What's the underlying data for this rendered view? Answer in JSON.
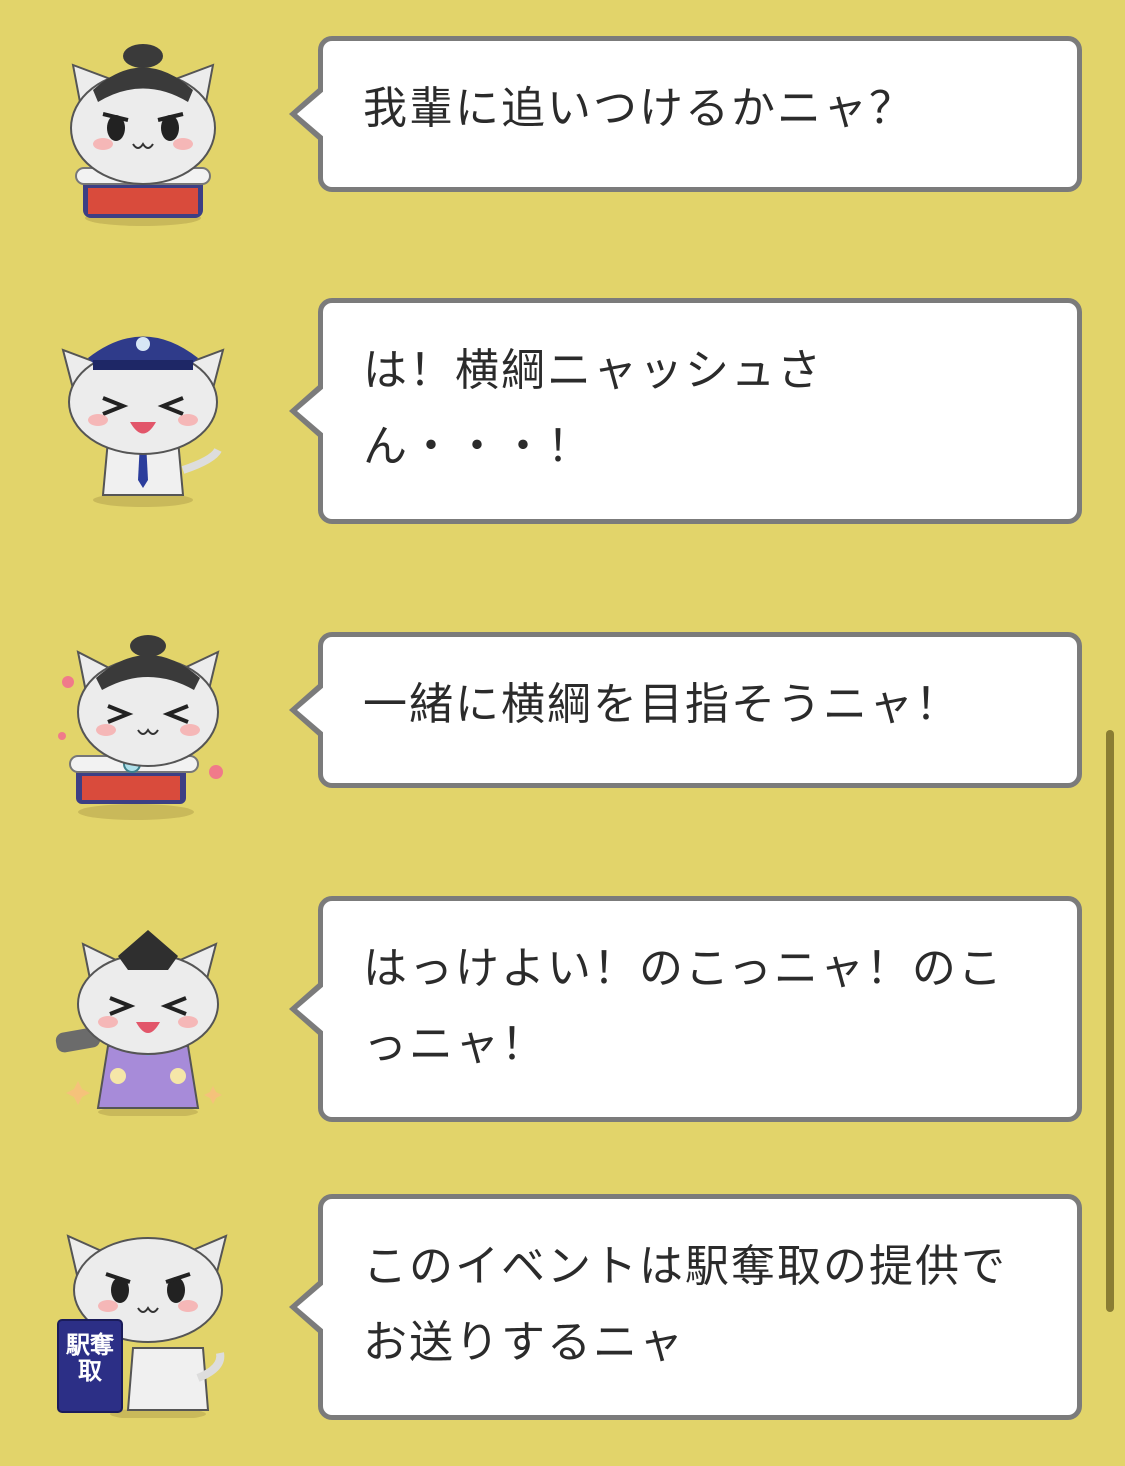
{
  "messages": [
    {
      "character": "sumo-cat-avatar",
      "text": "我輩に追いつけるかニャ？"
    },
    {
      "character": "conductor-cat-avatar",
      "text": "は！横綱ニャッシュさん・・・！"
    },
    {
      "character": "happy-sumo-cat-avatar",
      "text": "一緒に横綱を目指そうニャ！"
    },
    {
      "character": "referee-cat-avatar",
      "text": "はっけよい！のこっニャ！のこっニャ！"
    },
    {
      "character": "banner-cat-avatar",
      "text": "このイベントは駅奪取の提供でお送りするニャ",
      "banner_text": "駅奪取"
    }
  ],
  "colors": {
    "background": "#e2d46a",
    "bubble_border": "#7b7b7b",
    "bubble_fill": "#ffffff",
    "scrollbar": "#8a7d33"
  }
}
